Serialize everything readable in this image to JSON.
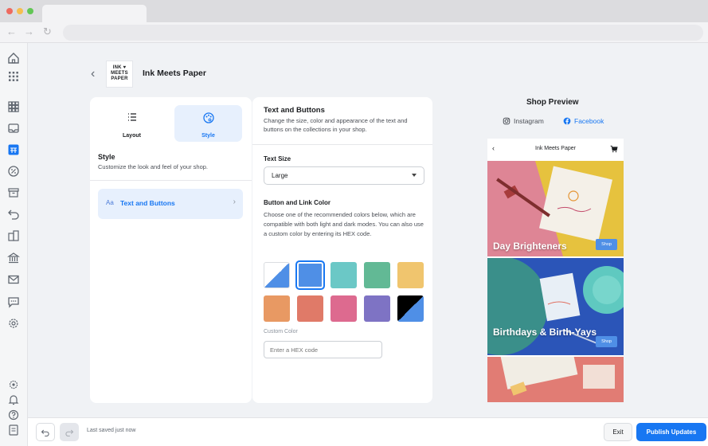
{
  "shop": {
    "name": "Ink Meets Paper",
    "logo_lines": [
      "INK ♥",
      "MEETS",
      "PAPER"
    ]
  },
  "panel": {
    "tabs": [
      {
        "label": "Layout",
        "icon": "layout-list-icon",
        "selected": false
      },
      {
        "label": "Style",
        "icon": "palette-icon",
        "selected": true
      }
    ],
    "style_title": "Style",
    "style_subtitle": "Customize the look and feel of your shop.",
    "menu_item": {
      "prefix": "Aa",
      "label": "Text and Buttons"
    }
  },
  "settings": {
    "title": "Text and Buttons",
    "description": "Change the size, color and appearance of the text and buttons on the collections in your shop.",
    "text_size_label": "Text Size",
    "text_size_value": "Large",
    "color_label": "Button and Link Color",
    "color_description": "Choose one of the recommended colors below, which are compatible with both light and dark modes. You can also use a custom color by entering its HEX code.",
    "swatches": [
      "#ffffff/#4f8fe6",
      "#4f8fe6",
      "#6bc8c6",
      "#62b995",
      "#f0c56e",
      "#e89963",
      "#e07a68",
      "#dd6a8f",
      "#7e73c4",
      "#000000/#4f8fe6"
    ],
    "selected_swatch": 1,
    "custom_color_label": "Custom Color",
    "custom_color_placeholder": "Enter a HEX code"
  },
  "preview": {
    "title": "Shop Preview",
    "channels": [
      {
        "label": "Instagram",
        "icon": "instagram-icon",
        "active": false
      },
      {
        "label": "Facebook",
        "icon": "facebook-icon",
        "active": true
      }
    ],
    "phone_title": "Ink Meets Paper",
    "tiles": [
      {
        "label": "Day Brighteners",
        "button": "Shop"
      },
      {
        "label": "Birthdays & Birth-Yays",
        "button": "Shop"
      }
    ]
  },
  "footer": {
    "status": "Last saved just now",
    "exit_label": "Exit",
    "publish_label": "Publish Updates"
  },
  "colors": {
    "accent": "#1877f2",
    "accent_light": "#e7f0fd"
  }
}
